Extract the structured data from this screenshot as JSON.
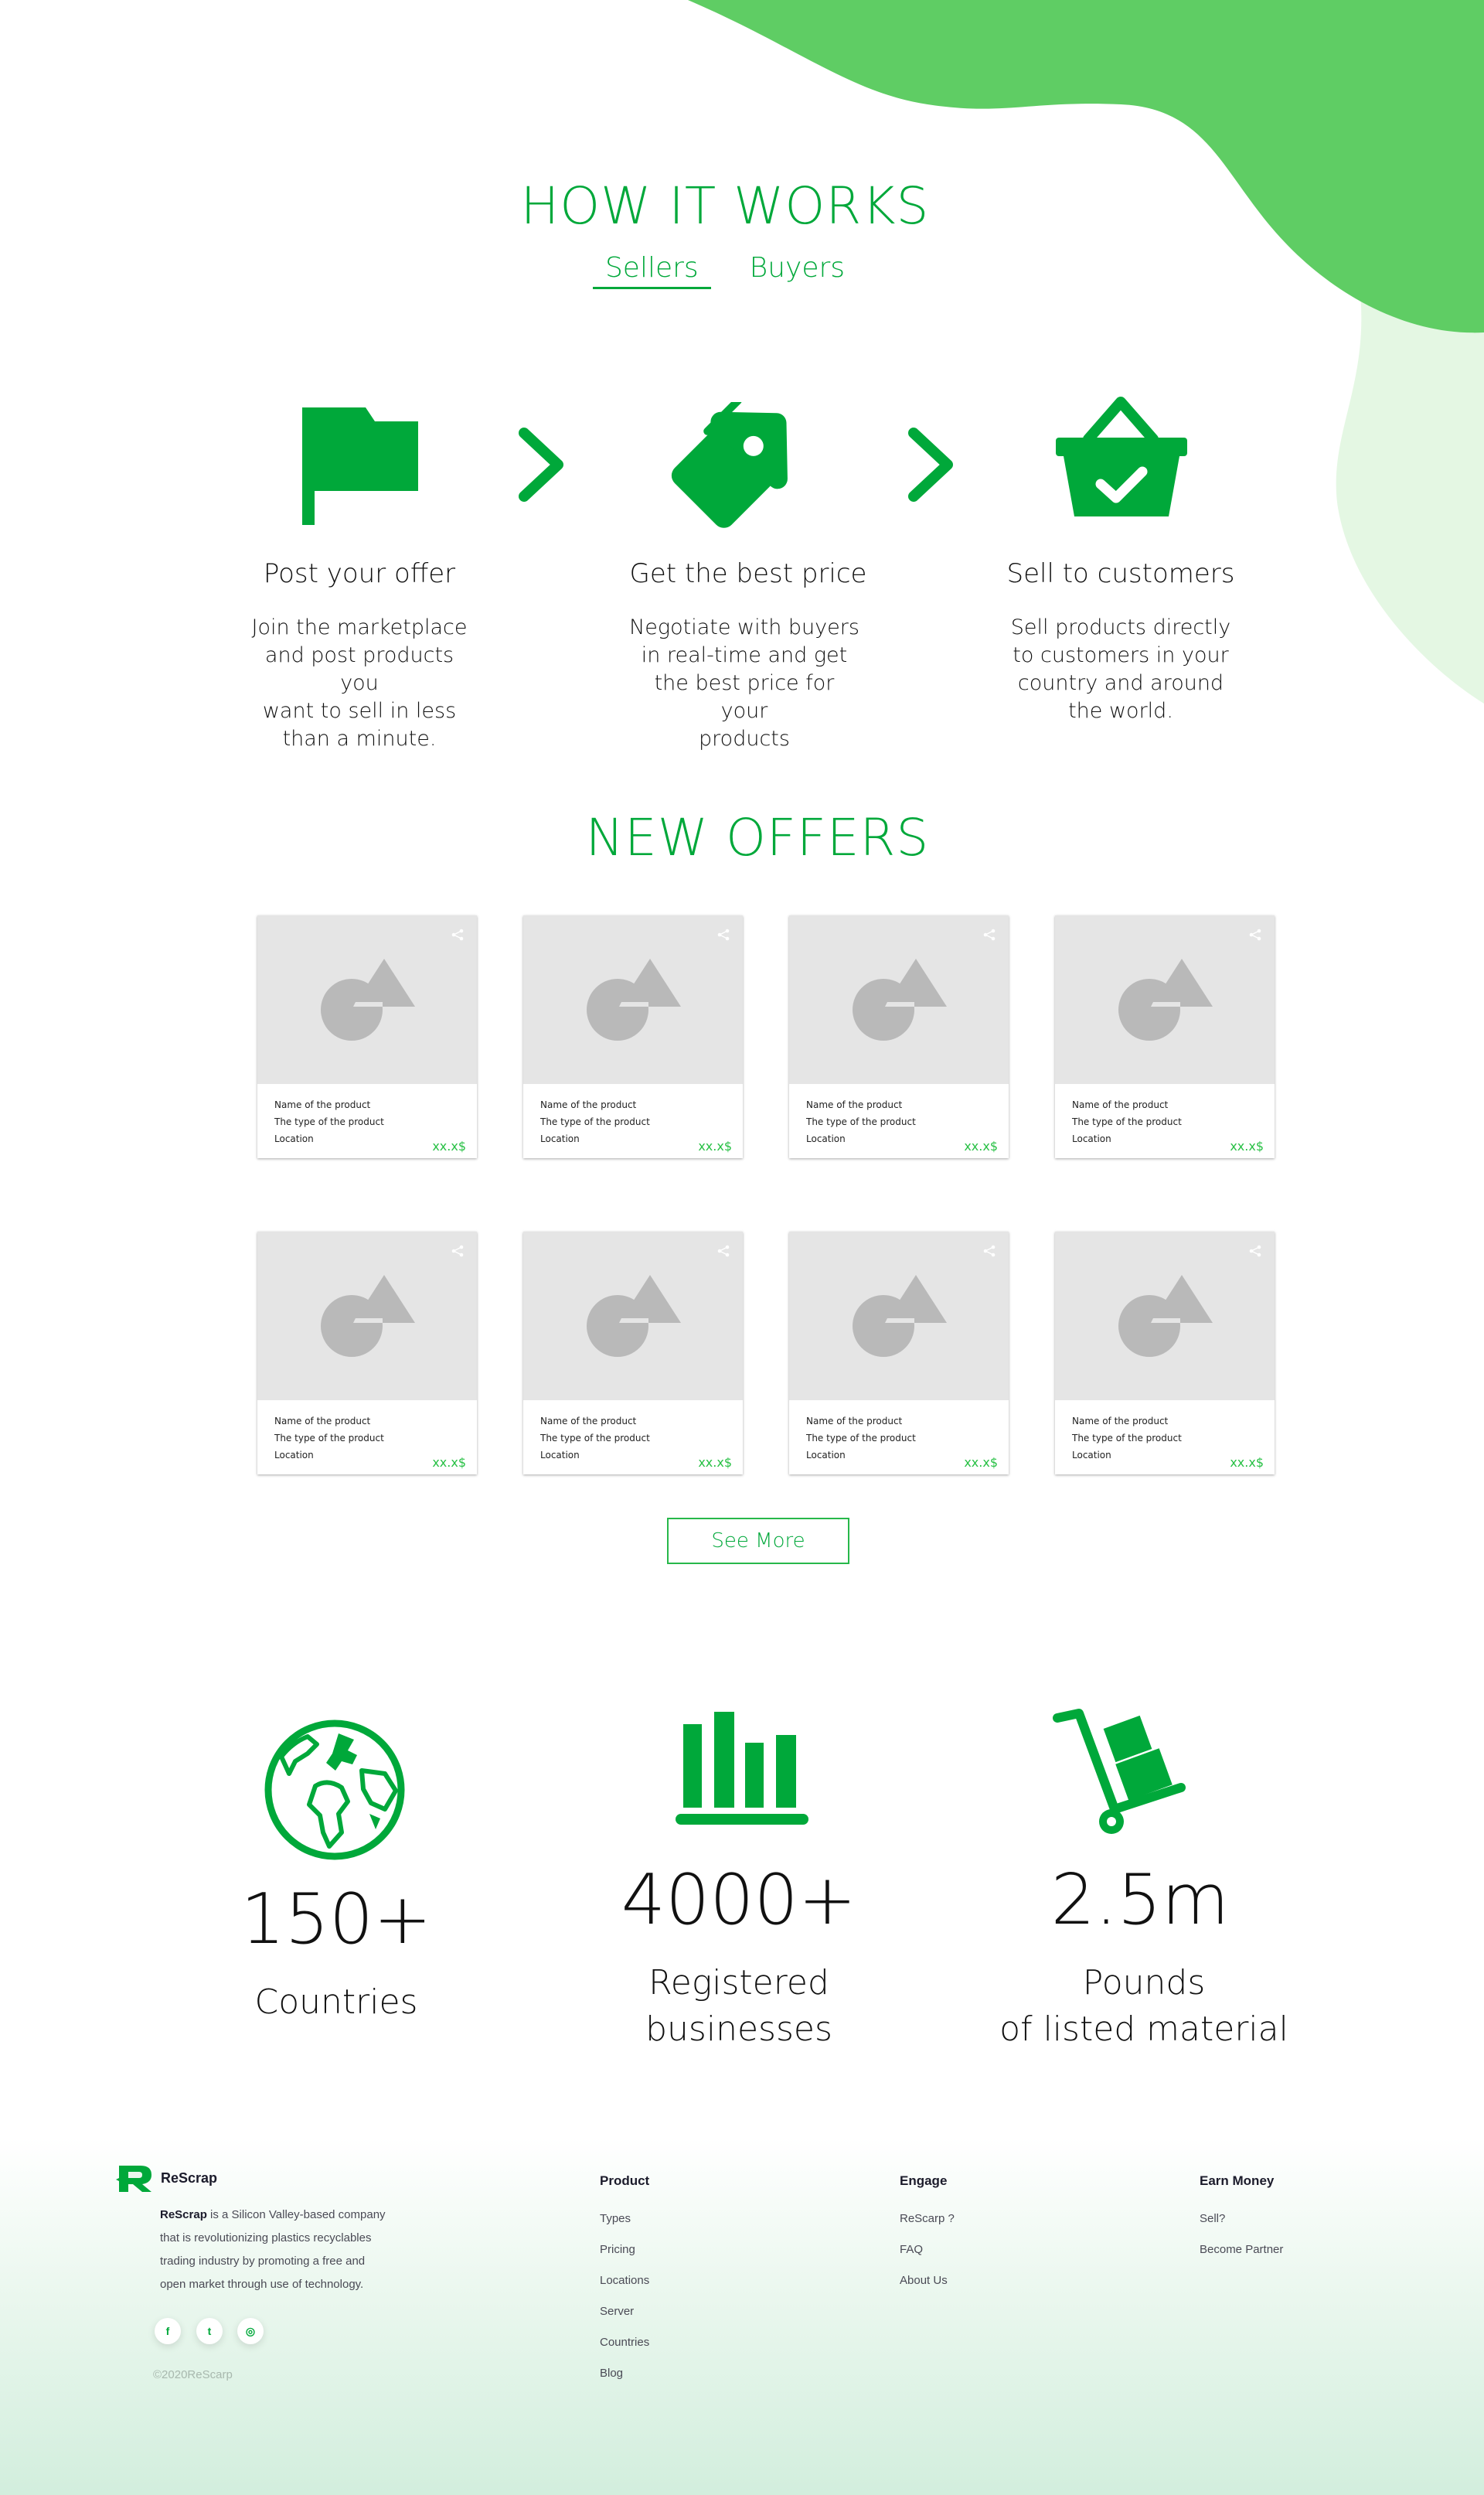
{
  "colors": {
    "brand_green": "#00a83a",
    "blob_green": "#5fcd64",
    "light_blob": "#e4f7e3",
    "price_green": "#27c044"
  },
  "how_it_works": {
    "title": "HOW IT WORKS",
    "tabs": [
      {
        "label": "Sellers",
        "active": true
      },
      {
        "label": "Buyers",
        "active": false
      }
    ],
    "steps": [
      {
        "icon": "flag-icon",
        "title": "Post your offer",
        "desc_lines": [
          "Join the marketplace",
          "and post products you",
          "want to sell in less",
          "than a minute."
        ]
      },
      {
        "icon": "price-tag-icon",
        "title": "Get the best price",
        "desc_lines": [
          "Negotiate with buyers",
          "in real-time and get",
          "the best price for your",
          "products"
        ]
      },
      {
        "icon": "shopping-basket-check-icon",
        "title": "Sell to customers",
        "desc_lines": [
          "Sell products directly",
          "to customers in your",
          "country and around",
          "the world."
        ]
      }
    ]
  },
  "new_offers": {
    "title": "NEW OFFERS",
    "cards": [
      {
        "name": "Name of the product",
        "type": "The type of the product",
        "location": "Location",
        "price": "xx.x$"
      },
      {
        "name": "Name of the product",
        "type": "The type of the product",
        "location": "Location",
        "price": "xx.x$"
      },
      {
        "name": "Name of the product",
        "type": "The type of the product",
        "location": "Location",
        "price": "xx.x$"
      },
      {
        "name": "Name of the product",
        "type": "The type of the product",
        "location": "Location",
        "price": "xx.x$"
      },
      {
        "name": "Name of the product",
        "type": "The type of the product",
        "location": "Location",
        "price": "xx.x$"
      },
      {
        "name": "Name of the product",
        "type": "The type of the product",
        "location": "Location",
        "price": "xx.x$"
      },
      {
        "name": "Name of the product",
        "type": "The type of the product",
        "location": "Location",
        "price": "xx.x$"
      },
      {
        "name": "Name of the product",
        "type": "The type of the product",
        "location": "Location",
        "price": "xx.x$"
      }
    ],
    "see_more": "See More"
  },
  "stats": [
    {
      "icon": "globe-icon",
      "value": "150+",
      "label_lines": [
        "Countries"
      ]
    },
    {
      "icon": "bar-chart-icon",
      "value": "4000+",
      "label_lines": [
        "Registered",
        "businesses"
      ]
    },
    {
      "icon": "hand-truck-icon",
      "value": "2.5m",
      "label_lines": [
        "Pounds",
        "of listed material"
      ]
    }
  ],
  "footer": {
    "brand": "ReScrap",
    "about_bold": "ReScrap",
    "about_lines": [
      " is a Silicon Valley-based company",
      "that is revolutionizing plastics recyclables",
      "trading industry by promoting a free and",
      "open market through use of technology."
    ],
    "social": [
      {
        "icon": "facebook-icon",
        "glyph": "f"
      },
      {
        "icon": "twitter-icon",
        "glyph": "t"
      },
      {
        "icon": "instagram-icon",
        "glyph": "◎"
      }
    ],
    "copyright": "©2020ReScarp",
    "columns": [
      {
        "heading": "Product",
        "links": [
          "Types",
          "Pricing",
          "Locations",
          "Server",
          "Countries",
          "Blog"
        ]
      },
      {
        "heading": "Engage",
        "links": [
          "ReScarp ?",
          "FAQ",
          "About Us"
        ]
      },
      {
        "heading": "Earn Money",
        "links": [
          "Sell?",
          "Become Partner"
        ]
      }
    ]
  }
}
